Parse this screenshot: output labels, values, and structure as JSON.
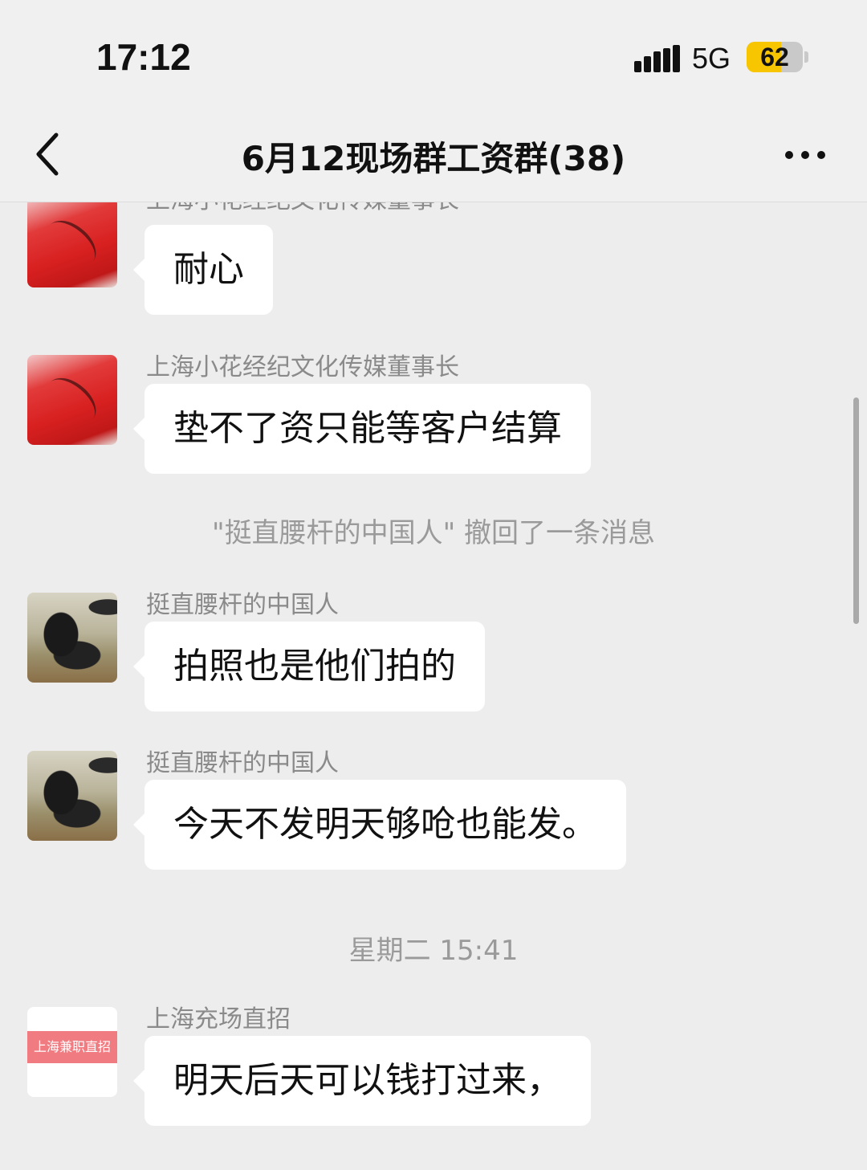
{
  "status_bar": {
    "time": "17:12",
    "network": "5G",
    "battery": 62,
    "battery_color": "#f7c600"
  },
  "header": {
    "back_icon": "chevron-left-icon",
    "title": "6月12现场群工资群(38)",
    "more_icon": "more-horizontal-icon"
  },
  "messages": [
    {
      "sender": "上海小花经纪文化传媒董事长",
      "text": "耐心",
      "avatar": "red-avatar"
    },
    {
      "sender": "上海小花经纪文化传媒董事长",
      "text": "垫不了资只能等客户结算",
      "avatar": "red-avatar"
    },
    {
      "sender": "挺直腰杆的中国人",
      "text": "拍照也是他们拍的",
      "avatar": "dog-avatar"
    },
    {
      "sender": "挺直腰杆的中国人",
      "text": "今天不发明天够呛也能发。",
      "avatar": "dog-avatar"
    },
    {
      "sender": "上海充场直招",
      "text": "明天后天可以钱打过来，",
      "avatar": "brand-avatar",
      "avatar_text": "上海兼职直招"
    }
  ],
  "system_notes": {
    "recall": "\"挺直腰杆的中国人\" 撤回了一条消息",
    "timestamp": "星期二 15:41"
  },
  "colors": {
    "chat_background": "#ededed",
    "bubble": "#ffffff",
    "brand_avatar_band": "#f07b80"
  }
}
